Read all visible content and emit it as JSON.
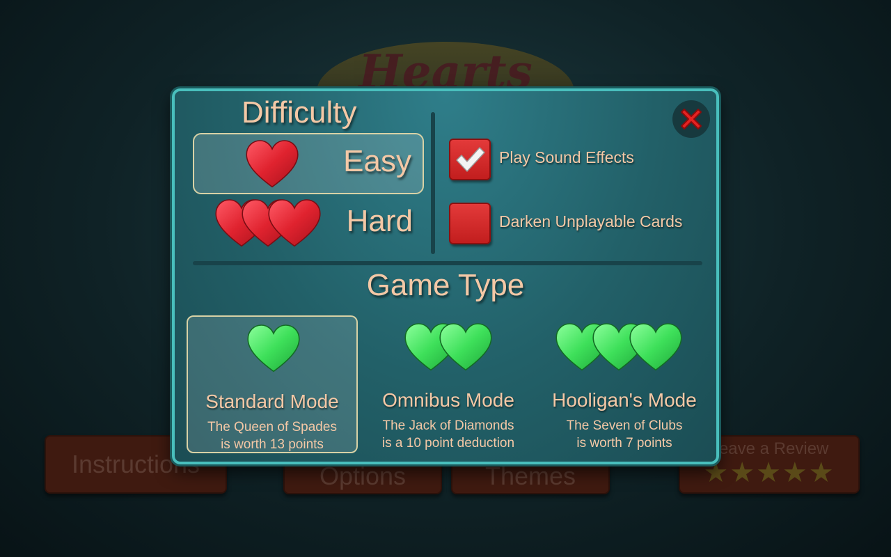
{
  "background": {
    "logo_text": "Hearts",
    "buttons": {
      "instructions": "Instructions",
      "options": "Options",
      "themes": "Themes",
      "review": "Leave a Review",
      "review_stars": "★★★★★"
    }
  },
  "dialog": {
    "difficulty": {
      "title": "Difficulty",
      "options": [
        {
          "label": "Easy",
          "selected": true,
          "hearts": 1
        },
        {
          "label": "Hard",
          "selected": false,
          "hearts": 3
        }
      ]
    },
    "settings": [
      {
        "label": "Play Sound Effects",
        "checked": true
      },
      {
        "label": "Darken Unplayable Cards",
        "checked": false
      }
    ],
    "game_type": {
      "title": "Game Type",
      "modes": [
        {
          "name": "Standard Mode",
          "line1": "The Queen of Spades",
          "line2": "is worth 13 points",
          "selected": true,
          "hearts": 1
        },
        {
          "name": "Omnibus Mode",
          "line1": "The Jack of Diamonds",
          "line2": "is a 10 point deduction",
          "selected": false,
          "hearts": 2
        },
        {
          "name": "Hooligan's Mode",
          "line1": "The Seven of Clubs",
          "line2": "is worth 7 points",
          "selected": false,
          "hearts": 3
        }
      ]
    },
    "close_icon": "close-x-icon"
  },
  "colors": {
    "text": "#f4c8a6",
    "panel": "#226068",
    "panel_border": "#49bfbd",
    "heart_red": "#e0232f",
    "heart_green": "#3ee05a",
    "checkbox_red": "#d42a2a"
  }
}
